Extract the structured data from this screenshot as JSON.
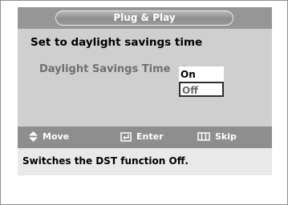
{
  "screen": {
    "title": "Plug & Play",
    "heading": "Set to daylight  savings time",
    "setting": {
      "label": "Daylight Savings Time",
      "separator": ":",
      "options": [
        "On",
        "Off"
      ],
      "selected": "Off"
    },
    "nav": {
      "move_label": "Move",
      "enter_label": "Enter",
      "skip_label": "Skip",
      "move_icon": "up-down-arrow-icon",
      "enter_icon": "enter-icon",
      "skip_icon": "skip-icon"
    },
    "help_text": "Switches the DST function Off."
  },
  "colors": {
    "panel_bg": "#cfcfcf",
    "bar_bg": "#8e8e8e",
    "help_bg": "#e9e9e9",
    "option_bg": "#ffffff"
  }
}
